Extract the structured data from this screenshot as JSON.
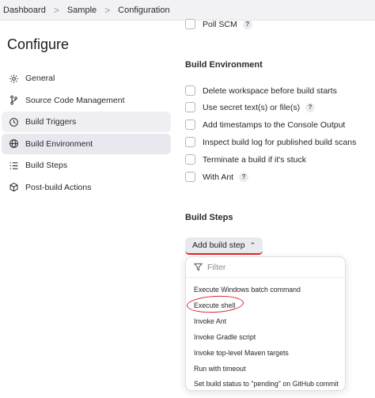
{
  "breadcrumb": {
    "items": [
      "Dashboard",
      "Sample",
      "Configuration"
    ],
    "separator": ">"
  },
  "page": {
    "title": "Configure"
  },
  "sidebar": {
    "items": [
      {
        "label": "General",
        "icon": "gear-icon"
      },
      {
        "label": "Source Code Management",
        "icon": "branch-icon"
      },
      {
        "label": "Build Triggers",
        "icon": "clock-icon"
      },
      {
        "label": "Build Environment",
        "icon": "globe-icon",
        "active": true
      },
      {
        "label": "Build Steps",
        "icon": "list-icon"
      },
      {
        "label": "Post-build Actions",
        "icon": "cube-icon"
      }
    ]
  },
  "triggers": {
    "poll_scm_label": "Poll SCM"
  },
  "build_environment": {
    "title": "Build Environment",
    "options": [
      {
        "label": "Delete workspace before build starts",
        "help": false
      },
      {
        "label": "Use secret text(s) or file(s)",
        "help": true
      },
      {
        "label": "Add timestamps to the Console Output",
        "help": false
      },
      {
        "label": "Inspect build log for published build scans",
        "help": false
      },
      {
        "label": "Terminate a build if it's stuck",
        "help": false
      },
      {
        "label": "With Ant",
        "help": true
      }
    ],
    "help_glyph": "?"
  },
  "build_steps": {
    "title": "Build Steps",
    "add_button_label": "Add build step",
    "chevron": "⌃"
  },
  "dropdown": {
    "filter_placeholder": "Filter",
    "items": [
      "Execute Windows batch command",
      "Execute shell",
      "Invoke Ant",
      "Invoke Gradle script",
      "Invoke top-level Maven targets",
      "Run with timeout",
      "Set build status to \"pending\" on GitHub commit"
    ],
    "highlighted_item": "Execute shell"
  },
  "colors": {
    "annotation_red": "#d9232a",
    "active_bg": "#e8e8ee",
    "breadcrumb_bg": "#f2f2f4"
  }
}
